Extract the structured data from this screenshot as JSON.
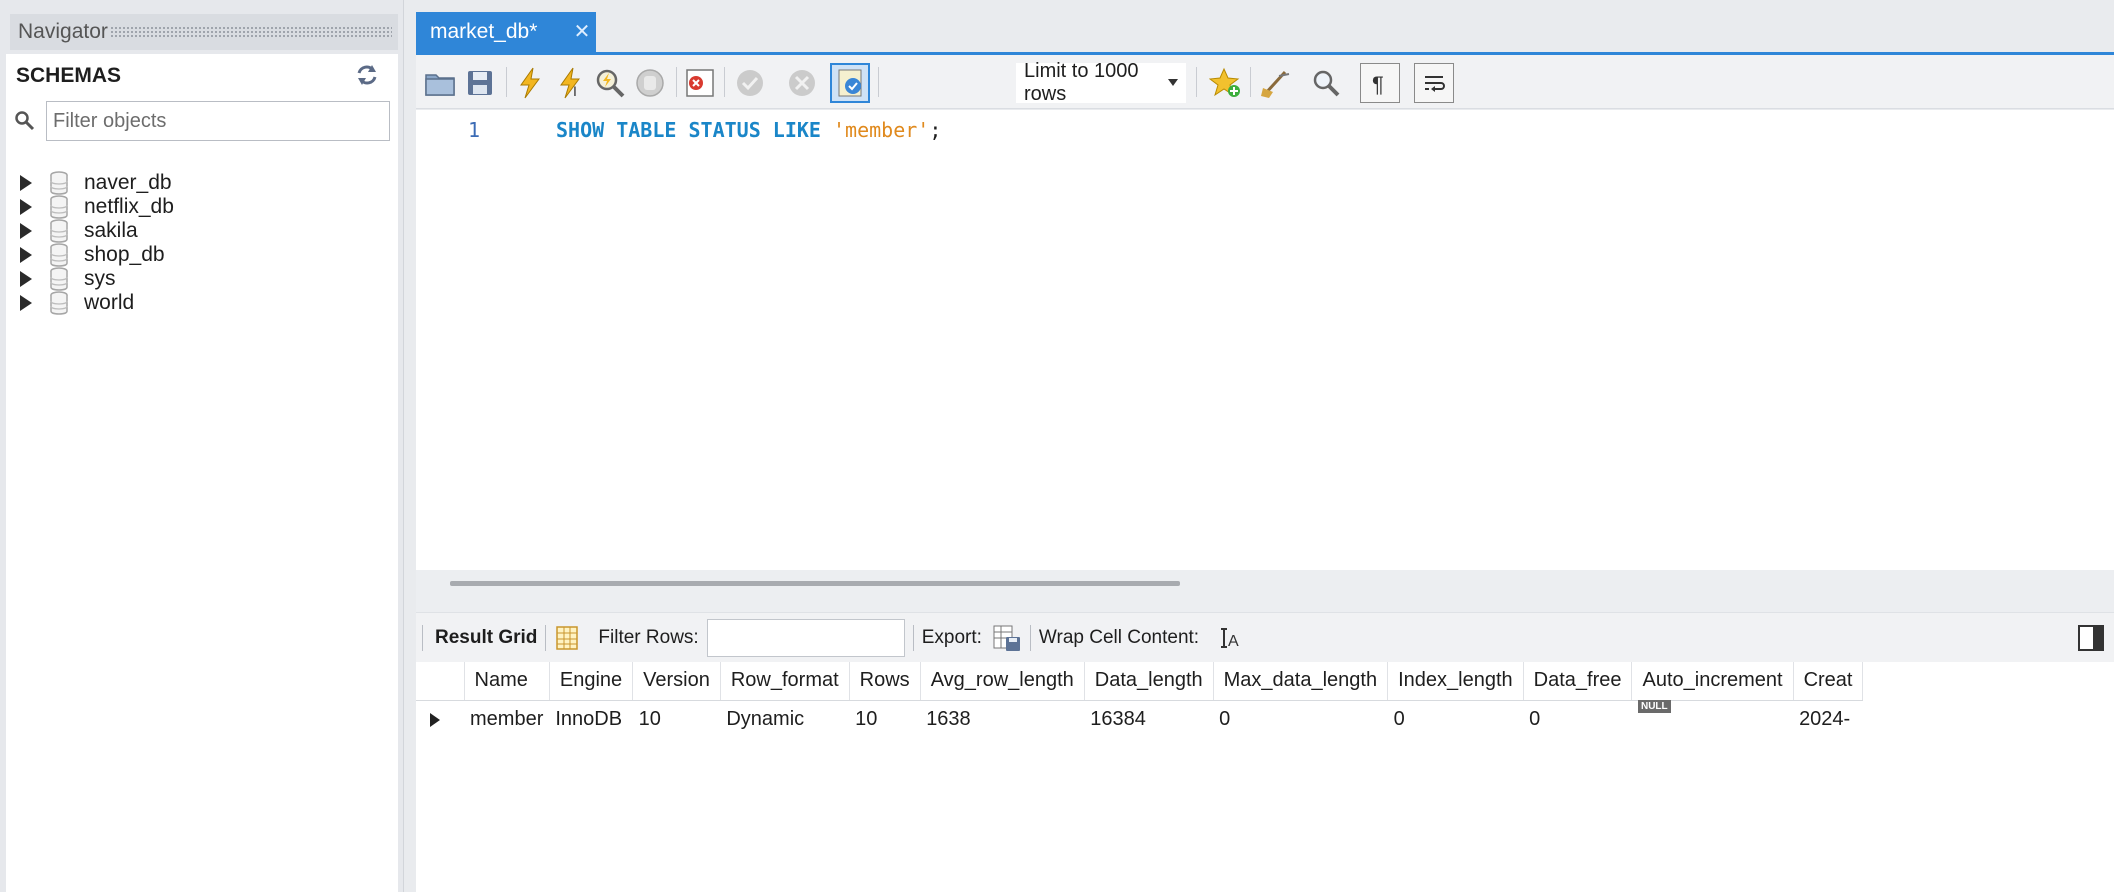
{
  "navigator": {
    "title": "Navigator",
    "schemas_title": "SCHEMAS",
    "filter_placeholder": "Filter objects",
    "schemas": [
      {
        "label": "naver_db"
      },
      {
        "label": "netflix_db"
      },
      {
        "label": "sakila"
      },
      {
        "label": "shop_db"
      },
      {
        "label": "sys"
      },
      {
        "label": "world"
      }
    ]
  },
  "tabs": [
    {
      "label": "market_db*",
      "close": "✕"
    }
  ],
  "toolbar": {
    "limit_select_value": "Limit to 1000 rows",
    "icons": [
      "open-file-icon",
      "save-icon",
      "execute-icon",
      "execute-statement-icon",
      "explain-icon",
      "stop-icon",
      "toggle-error-icon",
      "commit-icon",
      "rollback-icon",
      "autocommit-icon",
      "bookmark-icon",
      "beautify-icon",
      "find-icon",
      "invisible-chars-icon",
      "wrap-lines-icon"
    ]
  },
  "editor": {
    "line_number": "1",
    "tokens": [
      {
        "text": "SHOW",
        "kind": "kw"
      },
      {
        "text": " ",
        "kind": "punc"
      },
      {
        "text": "TABLE",
        "kind": "kw"
      },
      {
        "text": " ",
        "kind": "punc"
      },
      {
        "text": "STATUS",
        "kind": "kw"
      },
      {
        "text": " ",
        "kind": "punc"
      },
      {
        "text": "LIKE",
        "kind": "kw"
      },
      {
        "text": " ",
        "kind": "punc"
      },
      {
        "text": "'member'",
        "kind": "str"
      },
      {
        "text": ";",
        "kind": "punc"
      }
    ]
  },
  "result_toolbar": {
    "result_grid": "Result Grid",
    "filter_rows": "Filter Rows:",
    "export": "Export:",
    "wrap_cell": "Wrap Cell Content:"
  },
  "grid": {
    "columns": [
      "Name",
      "Engine",
      "Version",
      "Row_format",
      "Rows",
      "Avg_row_length",
      "Data_length",
      "Max_data_length",
      "Index_length",
      "Data_free",
      "Auto_increment",
      "Creat"
    ],
    "rows": [
      [
        "member",
        "InnoDB",
        "10",
        "Dynamic",
        "10",
        "1638",
        "16384",
        "0",
        "0",
        "0",
        "NULL",
        "2024-"
      ]
    ]
  }
}
